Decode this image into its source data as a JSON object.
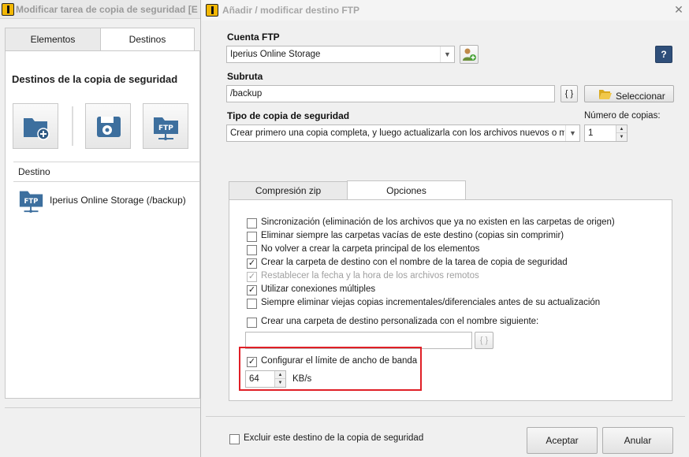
{
  "background_window": {
    "title": "Modificar tarea de copia de seguridad   [E",
    "tabs": [
      {
        "label": "Elementos",
        "active": false
      },
      {
        "label": "Destinos",
        "active": true
      }
    ],
    "panel_title": "Destinos de la copia de seguridad",
    "toolbar_icons": [
      "folder-add-icon",
      "disk-drive-icon",
      "ftp-folder-icon"
    ],
    "list_header": "Destino",
    "list_items": [
      {
        "icon": "ftp-folder-icon",
        "label": "Iperius Online Storage (/backup)"
      }
    ]
  },
  "dialog": {
    "title": "Añadir / modificar destino FTP",
    "ftp_account": {
      "label": "Cuenta FTP",
      "value": "Iperius Online Storage"
    },
    "subpath": {
      "label": "Subruta",
      "value": "/backup",
      "variables_button": "{ }",
      "select_button": "Seleccionar"
    },
    "backup_type": {
      "label": "Tipo de copia de seguridad",
      "value": "Crear primero una copia completa, y luego actualizarla con los archivos nuevos o modifica"
    },
    "copies": {
      "label": "Número de copias:",
      "value": "1"
    },
    "help_button": "?",
    "tabs": [
      {
        "label": "Compresión zip",
        "active": false
      },
      {
        "label": "Opciones",
        "active": true
      }
    ],
    "options": [
      {
        "label": "Sincronización (eliminación de los archivos que ya no existen en las carpetas de origen)",
        "checked": false,
        "enabled": true
      },
      {
        "label": "Eliminar siempre las carpetas vacías de este destino (copias sin comprimir)",
        "checked": false,
        "enabled": true
      },
      {
        "label": "No volver a crear la carpeta principal de los elementos",
        "checked": false,
        "enabled": true
      },
      {
        "label": "Crear la carpeta de destino con el nombre de la tarea de copia de seguridad",
        "checked": true,
        "enabled": true
      },
      {
        "label": "Restablecer la fecha y la hora de los archivos remotos",
        "checked": true,
        "enabled": false
      },
      {
        "label": "Utilizar conexiones múltiples",
        "checked": true,
        "enabled": true
      },
      {
        "label": "Siempre eliminar viejas copias incrementales/diferenciales antes de su actualización",
        "checked": false,
        "enabled": true
      }
    ],
    "custom_folder": {
      "label": "Crear una carpeta de destino personalizada con el nombre siguiente:",
      "checked": false,
      "value": "",
      "variables_button": "{ }"
    },
    "bandwidth": {
      "label": "Configurar el límite de ancho de banda",
      "checked": true,
      "value": "64",
      "unit": "KB/s"
    },
    "exclude": {
      "label": "Excluir este destino de la copia de seguridad",
      "checked": false
    },
    "accept_button": "Aceptar",
    "cancel_button": "Anular"
  },
  "colors": {
    "highlight": "#e01f26",
    "logo": "#f2b705",
    "icon_blue": "#3d6f9e"
  }
}
